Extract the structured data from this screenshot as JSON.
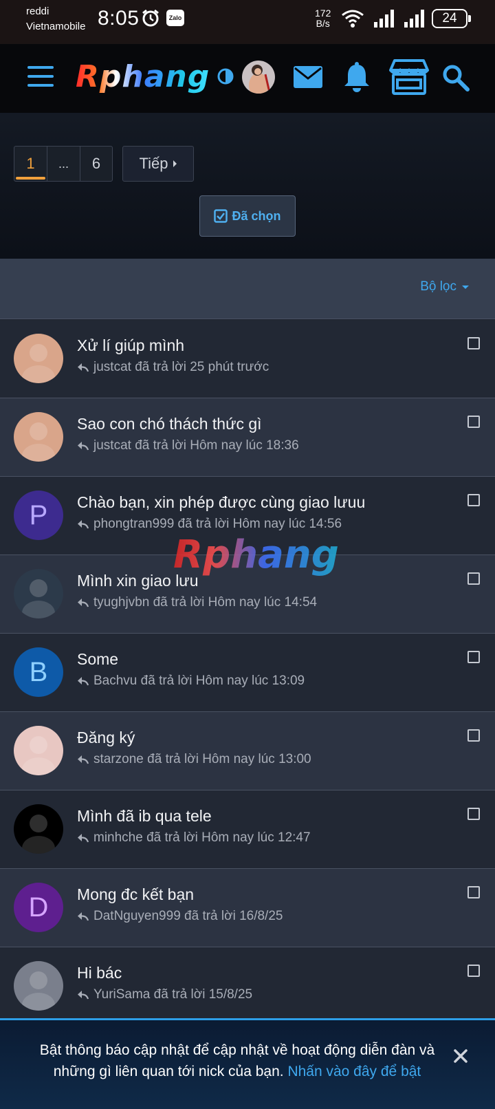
{
  "status_bar": {
    "carrier_line1": "reddi",
    "carrier_line2": "Vietnamobile",
    "time": "8:05",
    "zalo_label": "Zalo",
    "speed_value": "172",
    "speed_unit": "B/s",
    "battery": "24"
  },
  "header": {
    "logo_text": "Rphang"
  },
  "pagination": {
    "current_page": "1",
    "ellipsis": "...",
    "last_page": "6",
    "next_label": "Tiếp"
  },
  "selected_button": {
    "label": "Đã chọn"
  },
  "filter": {
    "label": "Bộ lọc"
  },
  "threads": [
    {
      "title": "Xử lí giúp mình",
      "meta": "justcat đã trả lời 25 phút trước",
      "avatar_type": "photo",
      "avatar_color": "#d9a58a"
    },
    {
      "title": "Sao con chó thách thức gì",
      "meta": "justcat đã trả lời Hôm nay lúc 18:36",
      "avatar_type": "photo",
      "avatar_color": "#d9a58a"
    },
    {
      "title": "Chào bạn, xin phép được cùng giao lưuu",
      "meta": "phongtran999 đã trả lời Hôm nay lúc 14:56",
      "avatar_type": "letter",
      "avatar_letter": "P",
      "avatar_color": "#3d2b8f",
      "avatar_text_color": "#b8a8ff"
    },
    {
      "title": "Mình xin giao lưu",
      "meta": "tyughjvbn đã trả lời Hôm nay lúc 14:54",
      "avatar_type": "photo",
      "avatar_color": "#2c3a4a"
    },
    {
      "title": "Some",
      "meta": "Bachvu đã trả lời Hôm nay lúc 13:09",
      "avatar_type": "letter",
      "avatar_letter": "B",
      "avatar_color": "#0e5aa8",
      "avatar_text_color": "#8fd0ff"
    },
    {
      "title": "Đăng ký",
      "meta": "starzone đã trả lời Hôm nay lúc 13:00",
      "avatar_type": "photo",
      "avatar_color": "#e8c7c2"
    },
    {
      "title": "Mình đã ib qua tele",
      "meta": "minhche đã trả lời Hôm nay lúc 12:47",
      "avatar_type": "photo",
      "avatar_color": "#000000"
    },
    {
      "title": "Mong đc kết bạn",
      "meta": "DatNguyen999 đã trả lời 16/8/25",
      "avatar_type": "letter",
      "avatar_letter": "D",
      "avatar_color": "#5e1f8f",
      "avatar_text_color": "#d6a4ff"
    },
    {
      "title": "Hi bác",
      "meta": "YuriSama đã trả lời 15/8/25",
      "avatar_type": "photo",
      "avatar_color": "#7a7f8c"
    }
  ],
  "watermark": "Rphang",
  "notice": {
    "text": "Bật thông báo cập nhật để cập nhật về hoạt động diễn đàn và những gì liên quan tới nick của bạn.",
    "link_text": "Nhấn vào đây để bật"
  },
  "colors": {
    "accent": "#3fa8ee",
    "current_page": "#f0a03c"
  }
}
